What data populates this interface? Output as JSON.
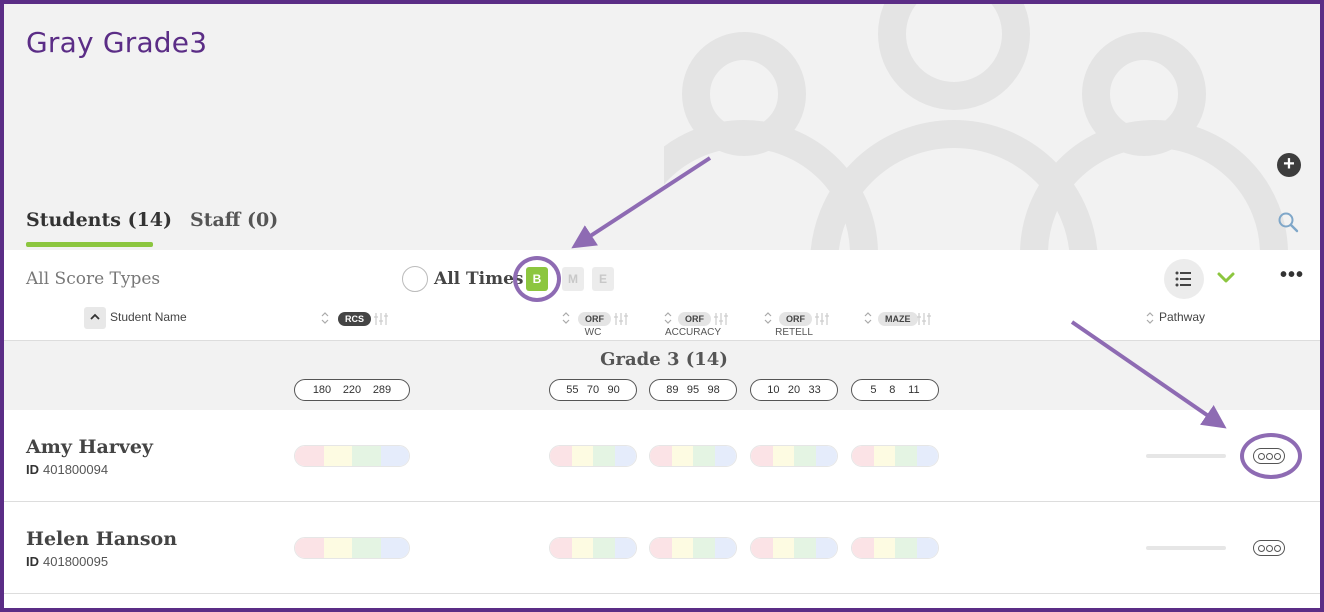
{
  "header": {
    "class_title": "Gray Grade3",
    "add_icon": "plus-circle-icon",
    "tabs": [
      {
        "label": "Students (14)",
        "active": true
      },
      {
        "label": "Staff (0)",
        "active": false
      }
    ],
    "search_icon": "search-icon"
  },
  "toolbar": {
    "score_types": "All Score Types",
    "all_times": "All Times",
    "periods": [
      "B",
      "M",
      "E"
    ],
    "selected_period": "B",
    "list_view_icon": "list-icon",
    "more_icon": "more-dots-icon"
  },
  "columns": {
    "student_name": "Student Name",
    "rcs": "RCS",
    "orf": "ORF",
    "orf_wc": "WC",
    "orf_accuracy": "ACCURACY",
    "orf_retell": "RETELL",
    "maze": "MAZE",
    "pathway": "Pathway"
  },
  "grade_group": {
    "title": "Grade 3 (14)",
    "benchmarks": {
      "rcs": [
        "180",
        "220",
        "289"
      ],
      "wc": [
        "55",
        "70",
        "90"
      ],
      "accuracy": [
        "89",
        "95",
        "98"
      ],
      "retell": [
        "10",
        "20",
        "33"
      ],
      "maze": [
        "5",
        "8",
        "11"
      ]
    }
  },
  "students": [
    {
      "name": "Amy Harvey",
      "id_label": "ID",
      "id": "401800094"
    },
    {
      "name": "Helen Hanson",
      "id_label": "ID",
      "id": "401800095"
    }
  ],
  "colors": {
    "brand_purple": "#5b2d86",
    "accent_green": "#8cc63f",
    "annotation_purple": "#8e6bb3"
  }
}
